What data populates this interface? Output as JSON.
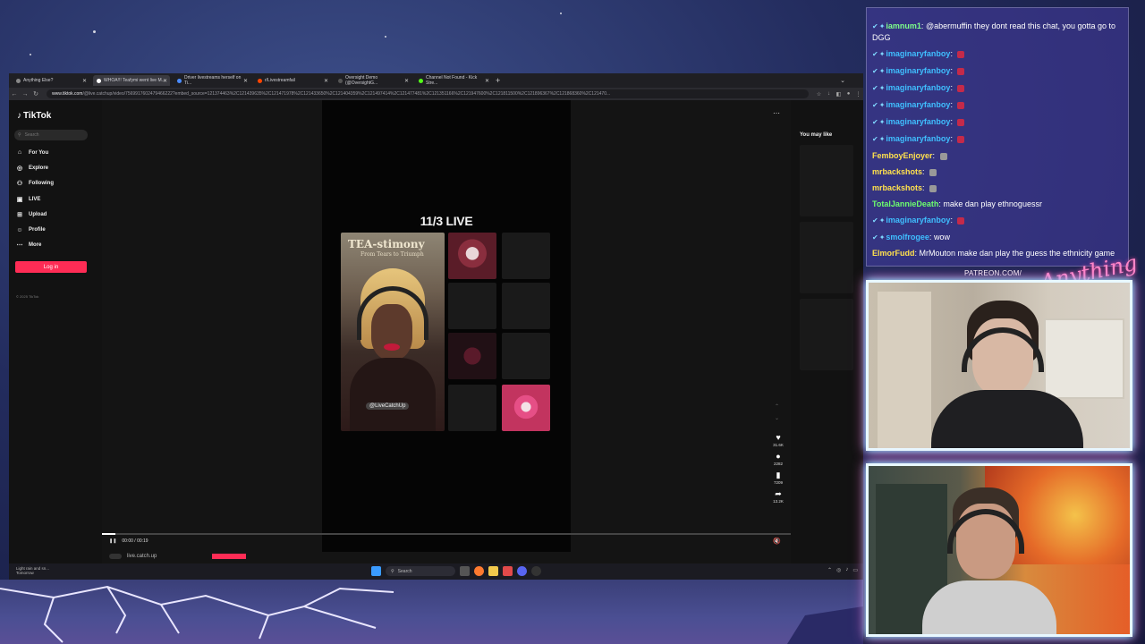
{
  "browser": {
    "tabs": [
      {
        "label": "Anything Else?",
        "active": false
      },
      {
        "label": "WHOA!!! Teafymi went live M...",
        "active": true
      },
      {
        "label": "Driver livestreams herself on Ti...",
        "active": false
      },
      {
        "label": "r/Livestreamfail",
        "active": false
      },
      {
        "label": "Oversight Demo (@OversightG...",
        "active": false
      },
      {
        "label": "Channel Not Found - Kick Stre...",
        "active": false
      }
    ],
    "url_host": "www.tiktok.com",
    "url_rest": "/@live.catchup/video/7569917602479466222?embed_source=121374463%2C121439635%2C121471978%2C121433650%2C121404359%2C121497414%2C121477481%2C121351166%2C121947600%2C121811500%2C121896367%2C121868360%2C121470..."
  },
  "tiktok": {
    "logo": "TikTok",
    "search_placeholder": "Search",
    "nav": [
      {
        "label": "For You",
        "icon": "home-icon"
      },
      {
        "label": "Explore",
        "icon": "compass-icon"
      },
      {
        "label": "Following",
        "icon": "users-icon"
      },
      {
        "label": "LIVE",
        "icon": "live-icon"
      },
      {
        "label": "Upload",
        "icon": "upload-icon"
      },
      {
        "label": "Profile",
        "icon": "user-icon"
      },
      {
        "label": "More",
        "icon": "more-icon"
      }
    ],
    "login": "Log in",
    "copyright": "© 2025 TikTok",
    "video": {
      "title": "11/3 LIVE",
      "overlay_title": "TEA-stimony",
      "overlay_subtitle": "From Tears to Triumph",
      "handle": "@LiveCatchUp",
      "time": "00:00 / 00:19",
      "author": "live.catch.up",
      "progress": 0.02
    },
    "stats": {
      "likes": "31.6K",
      "comments": "2282",
      "saves": "7209",
      "shares": "13.2K"
    },
    "you_may_like": "You may like"
  },
  "taskbar": {
    "weather_line1": "Light rain and sn...",
    "weather_line2": "Tomorrow",
    "search": "Search"
  },
  "chat": {
    "messages": [
      {
        "user": "iamnum1",
        "color": "#7dff8a",
        "text": "@abermuffin they dont read this chat, you gotta go to DGG",
        "badges": 2,
        "wrap": true
      },
      {
        "user": "imaginaryfanboy",
        "color": "#3fbfff",
        "text": "",
        "badges": 2,
        "emote": true
      },
      {
        "user": "imaginaryfanboy",
        "color": "#3fbfff",
        "text": "",
        "badges": 2,
        "emote": true
      },
      {
        "user": "imaginaryfanboy",
        "color": "#3fbfff",
        "text": "",
        "badges": 2,
        "emote": true
      },
      {
        "user": "imaginaryfanboy",
        "color": "#3fbfff",
        "text": "",
        "badges": 2,
        "emote": true
      },
      {
        "user": "imaginaryfanboy",
        "color": "#3fbfff",
        "text": "",
        "badges": 2,
        "emote": true
      },
      {
        "user": "imaginaryfanboy",
        "color": "#3fbfff",
        "text": "",
        "badges": 2,
        "emote": true
      },
      {
        "user": "FemboyEnjoyer",
        "color": "#ffe14d",
        "text": "",
        "badges": 0,
        "emote": true
      },
      {
        "user": "mrbackshots",
        "color": "#ffe14d",
        "text": "",
        "badges": 0,
        "emote": true
      },
      {
        "user": "mrbackshots",
        "color": "#ffe14d",
        "text": "",
        "badges": 0,
        "emote": true
      },
      {
        "user": "TotalJannieDeath",
        "color": "#6dff6d",
        "text": "make dan play ethnoguessr",
        "badges": 0
      },
      {
        "user": "imaginaryfanboy",
        "color": "#3fbfff",
        "text": "",
        "badges": 2,
        "emote": true
      },
      {
        "user": "smolfrogee",
        "color": "#3fbfff",
        "text": "wow",
        "badges": 2
      },
      {
        "user": "ElmorFudd",
        "color": "#ffe14d",
        "text": "MrMouton make dan play the guess the ethnicity game",
        "badges": 0,
        "wrap": true
      }
    ]
  },
  "overlay": {
    "patreon": "PATREON.COM/",
    "brand": "Anything Else?"
  }
}
